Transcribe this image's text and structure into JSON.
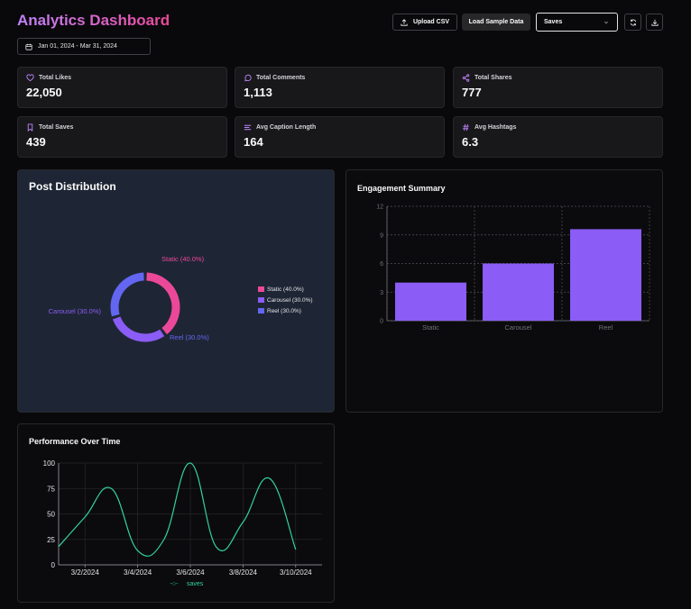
{
  "header": {
    "title": "Analytics Dashboard",
    "date_range": "Jan 01, 2024 - Mar 31, 2024",
    "upload_label": "Upload CSV",
    "sample_label": "Load Sample Data",
    "metric_select": "Saves"
  },
  "stats": [
    {
      "label": "Total Likes",
      "value": "22,050",
      "icon": "heart-icon"
    },
    {
      "label": "Total Comments",
      "value": "1,113",
      "icon": "comment-icon"
    },
    {
      "label": "Total Shares",
      "value": "777",
      "icon": "share-icon"
    },
    {
      "label": "Total Saves",
      "value": "439",
      "icon": "bookmark-icon"
    },
    {
      "label": "Avg Caption Length",
      "value": "164",
      "icon": "text-lines-icon"
    },
    {
      "label": "Avg Hashtags",
      "value": "6.3",
      "icon": "hash-icon"
    }
  ],
  "colors": {
    "static": "#ec4899",
    "carousel": "#8b5cf6",
    "reel": "#6366f1",
    "bar": "#8b5cf6",
    "line": "#34d399"
  },
  "chart_data": [
    {
      "type": "pie",
      "title": "Post Distribution",
      "categories": [
        "Static",
        "Carousel",
        "Reel"
      ],
      "values": [
        40,
        30,
        30
      ],
      "labels": [
        "Static (40.0%)",
        "Carousel (30.0%)",
        "Reel (30.0%)"
      ],
      "legend": "right"
    },
    {
      "type": "bar",
      "title": "Engagement Summary",
      "categories": [
        "Static",
        "Carousel",
        "Reel"
      ],
      "values": [
        4,
        6,
        9.6
      ],
      "ylim": [
        0,
        12
      ],
      "yticks": [
        "0",
        "3",
        "6",
        "9",
        "12"
      ],
      "grid": true
    },
    {
      "type": "line",
      "title": "Performance Over Time",
      "x": [
        "3/1/2024",
        "3/2/2024",
        "3/3/2024",
        "3/4/2024",
        "3/5/2024",
        "3/6/2024",
        "3/7/2024",
        "3/8/2024",
        "3/9/2024",
        "3/10/2024",
        "3/11/2024"
      ],
      "xticks": [
        "3/2/2024",
        "3/4/2024",
        "3/6/2024",
        "3/8/2024",
        "3/10/2024"
      ],
      "series": [
        {
          "name": "saves",
          "values": [
            18,
            47,
            75,
            14,
            25,
            100,
            17,
            42,
            85,
            15
          ]
        }
      ],
      "ylim": [
        0,
        100
      ],
      "yticks": [
        "0",
        "25",
        "50",
        "75",
        "100"
      ],
      "grid": true,
      "legend": "bottom"
    }
  ]
}
